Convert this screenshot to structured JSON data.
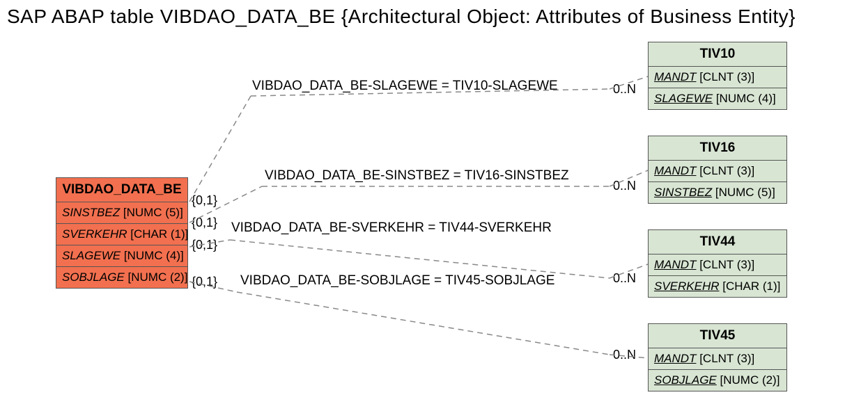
{
  "title": "SAP ABAP table VIBDAO_DATA_BE {Architectural Object: Attributes of Business Entity}",
  "primary": {
    "name": "VIBDAO_DATA_BE",
    "fields": [
      {
        "name": "SINSTBEZ",
        "type": "[NUMC (5)]"
      },
      {
        "name": "SVERKEHR",
        "type": "[CHAR (1)]"
      },
      {
        "name": "SLAGEWE",
        "type": "[NUMC (4)]"
      },
      {
        "name": "SOBJLAGE",
        "type": "[NUMC (2)]"
      }
    ]
  },
  "targets": [
    {
      "name": "TIV10",
      "fields": [
        {
          "name": "MANDT",
          "type": "[CLNT (3)]",
          "key": true
        },
        {
          "name": "SLAGEWE",
          "type": "[NUMC (4)]",
          "key": true
        }
      ]
    },
    {
      "name": "TIV16",
      "fields": [
        {
          "name": "MANDT",
          "type": "[CLNT (3)]",
          "key": true
        },
        {
          "name": "SINSTBEZ",
          "type": "[NUMC (5)]",
          "key": true
        }
      ]
    },
    {
      "name": "TIV44",
      "fields": [
        {
          "name": "MANDT",
          "type": "[CLNT (3)]",
          "key": true
        },
        {
          "name": "SVERKEHR",
          "type": "[CHAR (1)]",
          "key": true
        }
      ]
    },
    {
      "name": "TIV45",
      "fields": [
        {
          "name": "MANDT",
          "type": "[CLNT (3)]",
          "key": true
        },
        {
          "name": "SOBJLAGE",
          "type": "[NUMC (2)]",
          "key": true
        }
      ]
    }
  ],
  "relations": [
    {
      "label": "VIBDAO_DATA_BE-SLAGEWE = TIV10-SLAGEWE",
      "src_card": "{0,1}",
      "tgt_card": "0..N"
    },
    {
      "label": "VIBDAO_DATA_BE-SINSTBEZ = TIV16-SINSTBEZ",
      "src_card": "{0,1}",
      "tgt_card": "0..N"
    },
    {
      "label": "VIBDAO_DATA_BE-SVERKEHR = TIV44-SVERKEHR",
      "src_card": "{0,1}",
      "tgt_card": "0..N"
    },
    {
      "label": "VIBDAO_DATA_BE-SOBJLAGE = TIV45-SOBJLAGE",
      "src_card": "{0,1}",
      "tgt_card": "0..N"
    }
  ],
  "chart_data": {
    "type": "table",
    "title": "SAP ABAP table VIBDAO_DATA_BE — entity relationships",
    "entities": {
      "VIBDAO_DATA_BE": [
        "SINSTBEZ NUMC(5)",
        "SVERKEHR CHAR(1)",
        "SLAGEWE NUMC(4)",
        "SOBJLAGE NUMC(2)"
      ],
      "TIV10": [
        "MANDT CLNT(3)",
        "SLAGEWE NUMC(4)"
      ],
      "TIV16": [
        "MANDT CLNT(3)",
        "SINSTBEZ NUMC(5)"
      ],
      "TIV44": [
        "MANDT CLNT(3)",
        "SVERKEHR CHAR(1)"
      ],
      "TIV45": [
        "MANDT CLNT(3)",
        "SOBJLAGE NUMC(2)"
      ]
    },
    "relations": [
      {
        "from": "VIBDAO_DATA_BE.SLAGEWE",
        "to": "TIV10.SLAGEWE",
        "src_card": "0,1",
        "tgt_card": "0..N"
      },
      {
        "from": "VIBDAO_DATA_BE.SINSTBEZ",
        "to": "TIV16.SINSTBEZ",
        "src_card": "0,1",
        "tgt_card": "0..N"
      },
      {
        "from": "VIBDAO_DATA_BE.SVERKEHR",
        "to": "TIV44.SVERKEHR",
        "src_card": "0,1",
        "tgt_card": "0..N"
      },
      {
        "from": "VIBDAO_DATA_BE.SOBJLAGE",
        "to": "TIV45.SOBJLAGE",
        "src_card": "0,1",
        "tgt_card": "0..N"
      }
    ]
  }
}
